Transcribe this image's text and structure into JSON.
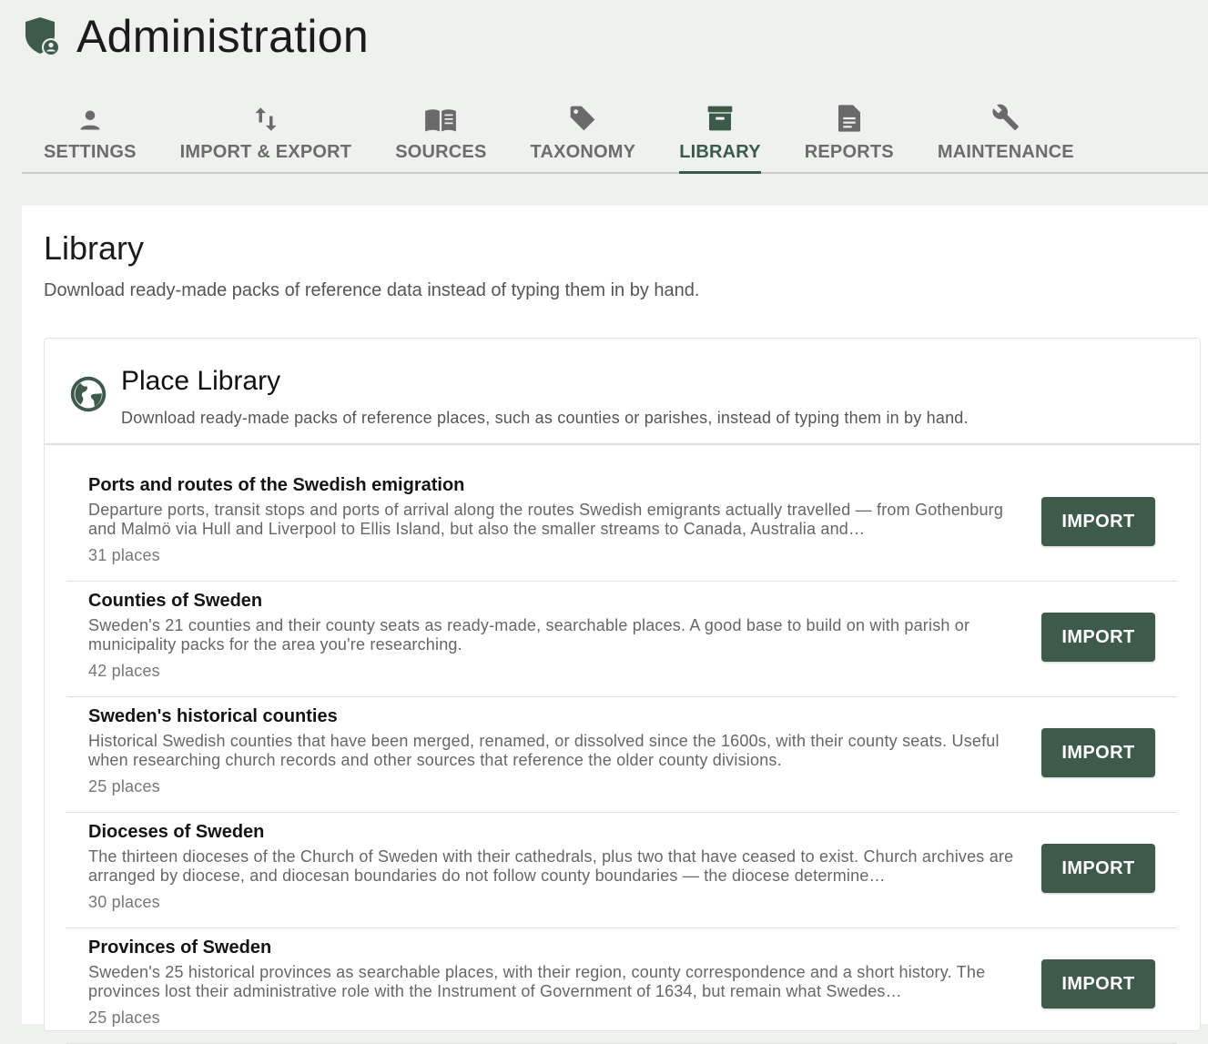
{
  "app": {
    "title": "Administration",
    "logo_icon": "shield-person-icon",
    "accent_color": "#3d5a4b"
  },
  "tabs": [
    {
      "label": "SETTINGS",
      "icon": "person-icon",
      "active": false
    },
    {
      "label": "IMPORT & EXPORT",
      "icon": "swap-vertical-icon",
      "active": false
    },
    {
      "label": "SOURCES",
      "icon": "book-icon",
      "active": false
    },
    {
      "label": "TAXONOMY",
      "icon": "tag-icon",
      "active": false
    },
    {
      "label": "LIBRARY",
      "icon": "archive-icon",
      "active": true
    },
    {
      "label": "REPORTS",
      "icon": "document-icon",
      "active": false
    },
    {
      "label": "MAINTENANCE",
      "icon": "wrench-icon",
      "active": false
    }
  ],
  "page": {
    "title": "Library",
    "subtitle": "Download ready-made packs of reference data instead of typing them in by hand."
  },
  "place_library": {
    "icon": "globe-icon",
    "title": "Place Library",
    "subtitle": "Download ready-made packs of reference places, such as counties or parishes, instead of typing them in by hand.",
    "import_label": "IMPORT",
    "items": [
      {
        "title": "Ports and routes of the Swedish emigration",
        "description": "Departure ports, transit stops and ports of arrival along the routes Swedish emigrants actually travelled — from Gothenburg and Malmö via Hull and Liverpool to Ellis Island, but also the smaller streams to Canada, Australia and…",
        "count": "31 places"
      },
      {
        "title": "Counties of Sweden",
        "description": "Sweden's 21 counties and their county seats as ready-made, searchable places. A good base to build on with parish or municipality packs for the area you're researching.",
        "count": "42 places"
      },
      {
        "title": "Sweden's historical counties",
        "description": "Historical Swedish counties that have been merged, renamed, or dissolved since the 1600s, with their county seats. Useful when researching church records and other sources that reference the older county divisions.",
        "count": "25 places"
      },
      {
        "title": "Dioceses of Sweden",
        "description": "The thirteen dioceses of the Church of Sweden with their cathedrals, plus two that have ceased to exist. Church archives are arranged by diocese, and diocesan boundaries do not follow county boundaries — the diocese determine…",
        "count": "30 places"
      },
      {
        "title": "Provinces of Sweden",
        "description": "Sweden's 25 historical provinces as searchable places, with their region, county correspondence and a short history. The provinces lost their administrative role with the Instrument of Government of 1634, but remain what Swedes…",
        "count": "25 places"
      }
    ]
  }
}
